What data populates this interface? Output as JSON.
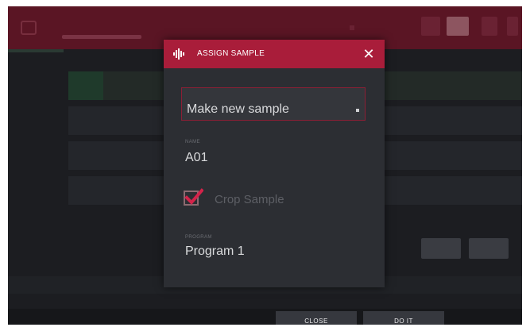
{
  "dialog": {
    "title": "ASSIGN SAMPLE",
    "icon": "waveform-icon",
    "close_icon": "close-icon",
    "dropdown": {
      "label": "",
      "value": "Make new sample"
    },
    "name": {
      "label": "NAME",
      "value": "A01"
    },
    "crop": {
      "label": "Crop Sample",
      "checked": true
    },
    "program": {
      "label": "PROGRAM",
      "value": "Program 1"
    }
  },
  "actions": {
    "close_label": "CLOSE",
    "doit_label": "DO IT"
  },
  "colors": {
    "header": "#a91d3a",
    "background": "#1c1d21",
    "dialog": "#2c2e33",
    "check": "#d4234a"
  }
}
